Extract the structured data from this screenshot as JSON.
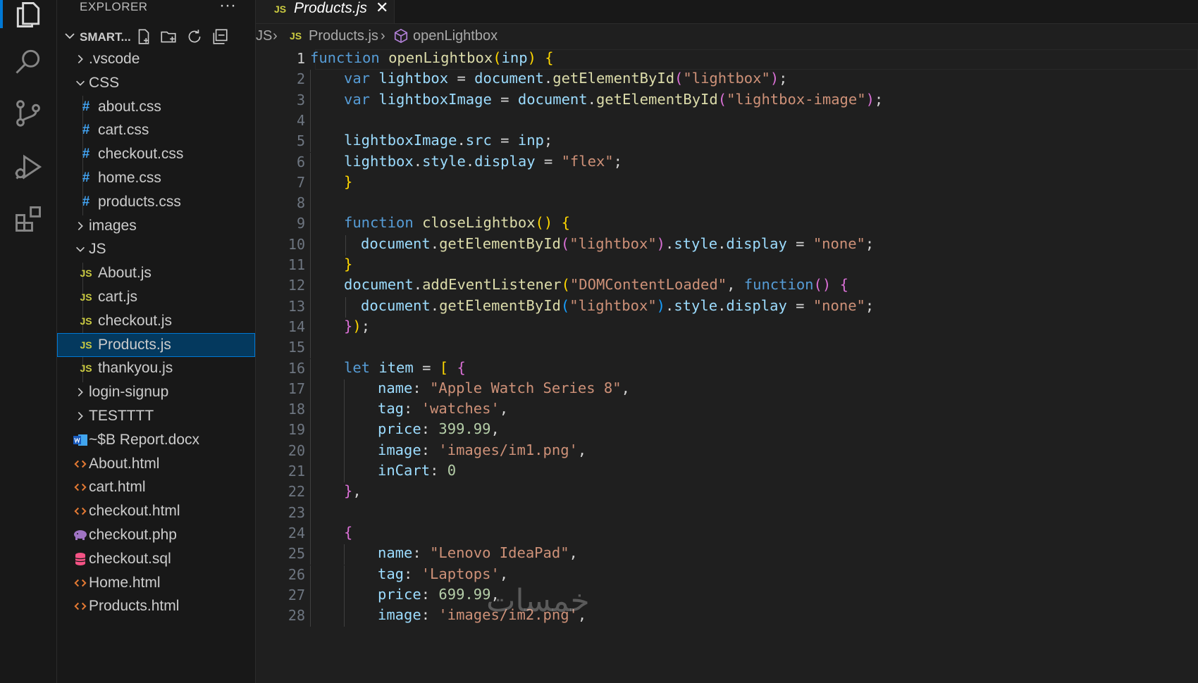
{
  "sidebar": {
    "title": "EXPLORER",
    "more": "···",
    "workspace": "SMART...",
    "items": [
      {
        "label": ".vscode",
        "icon": "chevron-right",
        "depth": 0
      },
      {
        "label": "CSS",
        "icon": "chevron-down",
        "depth": 0
      },
      {
        "label": "about.css",
        "icon": "#",
        "depth": 1
      },
      {
        "label": "cart.css",
        "icon": "#",
        "depth": 1
      },
      {
        "label": "checkout.css",
        "icon": "#",
        "depth": 1
      },
      {
        "label": "home.css",
        "icon": "#",
        "depth": 1
      },
      {
        "label": "products.css",
        "icon": "#",
        "depth": 1
      },
      {
        "label": "images",
        "icon": "chevron-right",
        "depth": 0
      },
      {
        "label": "JS",
        "icon": "chevron-down",
        "depth": 0
      },
      {
        "label": "About.js",
        "icon": "JS",
        "depth": 1
      },
      {
        "label": "cart.js",
        "icon": "JS",
        "depth": 1
      },
      {
        "label": "checkout.js",
        "icon": "JS",
        "depth": 1
      },
      {
        "label": "Products.js",
        "icon": "JS",
        "depth": 1,
        "selected": true
      },
      {
        "label": "thankyou.js",
        "icon": "JS",
        "depth": 1
      },
      {
        "label": "login-signup",
        "icon": "chevron-right",
        "depth": 0
      },
      {
        "label": "TESTTTT",
        "icon": "chevron-right",
        "depth": 0
      },
      {
        "label": "~$B Report.docx",
        "icon": "word",
        "depth": 0
      },
      {
        "label": "About.html",
        "icon": "html",
        "depth": 0
      },
      {
        "label": "cart.html",
        "icon": "html",
        "depth": 0
      },
      {
        "label": "checkout.html",
        "icon": "html",
        "depth": 0
      },
      {
        "label": "checkout.php",
        "icon": "php",
        "depth": 0
      },
      {
        "label": "checkout.sql",
        "icon": "sql",
        "depth": 0
      },
      {
        "label": "Home.html",
        "icon": "html",
        "depth": 0
      },
      {
        "label": "Products.html",
        "icon": "html",
        "depth": 0
      }
    ]
  },
  "tab": {
    "badge": "JS",
    "name": "Products.js",
    "close": "✕"
  },
  "breadcrumb": {
    "folder": "JS",
    "sep": "›",
    "badge": "JS",
    "file": "Products.js",
    "symbol": "openLightbox"
  },
  "editor": {
    "active_line": 1,
    "lines": [
      {
        "n": "1",
        "indent": 0,
        "tokens": [
          [
            "kw",
            "function "
          ],
          [
            "fn",
            "openLightbox"
          ],
          [
            "b1",
            "("
          ],
          [
            "vr",
            "inp"
          ],
          [
            "b1",
            ")"
          ],
          [
            "op",
            " "
          ],
          [
            "b1",
            "{"
          ]
        ]
      },
      {
        "n": "2",
        "indent": 1,
        "tokens": [
          [
            "kw",
            "var "
          ],
          [
            "vr",
            "lightbox"
          ],
          [
            "op",
            " = "
          ],
          [
            "vr",
            "document"
          ],
          [
            "op",
            "."
          ],
          [
            "fn",
            "getElementById"
          ],
          [
            "b2",
            "("
          ],
          [
            "st",
            "\"lightbox\""
          ],
          [
            "b2",
            ")"
          ],
          [
            "op",
            ";"
          ]
        ]
      },
      {
        "n": "3",
        "indent": 1,
        "tokens": [
          [
            "kw",
            "var "
          ],
          [
            "vr",
            "lightboxImage"
          ],
          [
            "op",
            " = "
          ],
          [
            "vr",
            "document"
          ],
          [
            "op",
            "."
          ],
          [
            "fn",
            "getElementById"
          ],
          [
            "b2",
            "("
          ],
          [
            "st",
            "\"lightbox-image\""
          ],
          [
            "b2",
            ")"
          ],
          [
            "op",
            ";"
          ]
        ]
      },
      {
        "n": "4",
        "indent": 1,
        "tokens": []
      },
      {
        "n": "5",
        "indent": 1,
        "tokens": [
          [
            "vr",
            "lightboxImage"
          ],
          [
            "op",
            "."
          ],
          [
            "vr",
            "src"
          ],
          [
            "op",
            " = "
          ],
          [
            "vr",
            "inp"
          ],
          [
            "op",
            ";"
          ]
        ]
      },
      {
        "n": "6",
        "indent": 1,
        "tokens": [
          [
            "vr",
            "lightbox"
          ],
          [
            "op",
            "."
          ],
          [
            "vr",
            "style"
          ],
          [
            "op",
            "."
          ],
          [
            "vr",
            "display"
          ],
          [
            "op",
            " = "
          ],
          [
            "st",
            "\"flex\""
          ],
          [
            "op",
            ";"
          ]
        ]
      },
      {
        "n": "7",
        "indent": 1,
        "tokens": [
          [
            "b1",
            "}"
          ]
        ]
      },
      {
        "n": "8",
        "indent": 1,
        "tokens": []
      },
      {
        "n": "9",
        "indent": 1,
        "tokens": [
          [
            "kw",
            "function "
          ],
          [
            "fn",
            "closeLightbox"
          ],
          [
            "b1",
            "()"
          ],
          [
            "op",
            " "
          ],
          [
            "b1",
            "{"
          ]
        ]
      },
      {
        "n": "10",
        "indent": 1.5,
        "tokens": [
          [
            "vr",
            "document"
          ],
          [
            "op",
            "."
          ],
          [
            "fn",
            "getElementById"
          ],
          [
            "b2",
            "("
          ],
          [
            "st",
            "\"lightbox\""
          ],
          [
            "b2",
            ")"
          ],
          [
            "op",
            "."
          ],
          [
            "vr",
            "style"
          ],
          [
            "op",
            "."
          ],
          [
            "vr",
            "display"
          ],
          [
            "op",
            " = "
          ],
          [
            "st",
            "\"none\""
          ],
          [
            "op",
            ";"
          ]
        ]
      },
      {
        "n": "11",
        "indent": 1,
        "tokens": [
          [
            "b1",
            "}"
          ]
        ]
      },
      {
        "n": "12",
        "indent": 1,
        "tokens": [
          [
            "vr",
            "document"
          ],
          [
            "op",
            "."
          ],
          [
            "fn",
            "addEventListener"
          ],
          [
            "b1",
            "("
          ],
          [
            "st",
            "\"DOMContentLoaded\""
          ],
          [
            "op",
            ", "
          ],
          [
            "kw",
            "function"
          ],
          [
            "b2",
            "()"
          ],
          [
            "op",
            " "
          ],
          [
            "b2",
            "{"
          ]
        ]
      },
      {
        "n": "13",
        "indent": 1.5,
        "tokens": [
          [
            "vr",
            "document"
          ],
          [
            "op",
            "."
          ],
          [
            "fn",
            "getElementById"
          ],
          [
            "b3",
            "("
          ],
          [
            "st",
            "\"lightbox\""
          ],
          [
            "b3",
            ")"
          ],
          [
            "op",
            "."
          ],
          [
            "vr",
            "style"
          ],
          [
            "op",
            "."
          ],
          [
            "vr",
            "display"
          ],
          [
            "op",
            " = "
          ],
          [
            "st",
            "\"none\""
          ],
          [
            "op",
            ";"
          ]
        ]
      },
      {
        "n": "14",
        "indent": 1,
        "tokens": [
          [
            "b2",
            "}"
          ],
          [
            "b1",
            ")"
          ],
          [
            "op",
            ";"
          ]
        ]
      },
      {
        "n": "15",
        "indent": 1,
        "tokens": []
      },
      {
        "n": "16",
        "indent": 1,
        "tokens": [
          [
            "kw",
            "let "
          ],
          [
            "vr",
            "item"
          ],
          [
            "op",
            " = "
          ],
          [
            "b1",
            "["
          ],
          [
            "op",
            " "
          ],
          [
            "b2",
            "{"
          ]
        ]
      },
      {
        "n": "17",
        "indent": 2,
        "tokens": [
          [
            "vr",
            "name"
          ],
          [
            "op",
            ": "
          ],
          [
            "st",
            "\"Apple Watch Series 8\""
          ],
          [
            "op",
            ","
          ]
        ]
      },
      {
        "n": "18",
        "indent": 2,
        "tokens": [
          [
            "vr",
            "tag"
          ],
          [
            "op",
            ": "
          ],
          [
            "st",
            "'watches'"
          ],
          [
            "op",
            ","
          ]
        ]
      },
      {
        "n": "19",
        "indent": 2,
        "tokens": [
          [
            "vr",
            "price"
          ],
          [
            "op",
            ": "
          ],
          [
            "nm",
            "399.99"
          ],
          [
            "op",
            ","
          ]
        ]
      },
      {
        "n": "20",
        "indent": 2,
        "tokens": [
          [
            "vr",
            "image"
          ],
          [
            "op",
            ": "
          ],
          [
            "st",
            "'images/im1.png'"
          ],
          [
            "op",
            ","
          ]
        ]
      },
      {
        "n": "21",
        "indent": 2,
        "tokens": [
          [
            "vr",
            "inCart"
          ],
          [
            "op",
            ": "
          ],
          [
            "nm",
            "0"
          ]
        ]
      },
      {
        "n": "22",
        "indent": 1,
        "tokens": [
          [
            "b2",
            "}"
          ],
          [
            "op",
            ","
          ]
        ]
      },
      {
        "n": "23",
        "indent": 1,
        "tokens": []
      },
      {
        "n": "24",
        "indent": 1,
        "tokens": [
          [
            "b2",
            "{"
          ]
        ]
      },
      {
        "n": "25",
        "indent": 2,
        "tokens": [
          [
            "vr",
            "name"
          ],
          [
            "op",
            ": "
          ],
          [
            "st",
            "\"Lenovo IdeaPad\""
          ],
          [
            "op",
            ","
          ]
        ]
      },
      {
        "n": "26",
        "indent": 2,
        "tokens": [
          [
            "vr",
            "tag"
          ],
          [
            "op",
            ": "
          ],
          [
            "st",
            "'Laptops'"
          ],
          [
            "op",
            ","
          ]
        ]
      },
      {
        "n": "27",
        "indent": 2,
        "tokens": [
          [
            "vr",
            "price"
          ],
          [
            "op",
            ": "
          ],
          [
            "nm",
            "699.99"
          ],
          [
            "op",
            ","
          ]
        ]
      },
      {
        "n": "28",
        "indent": 2,
        "tokens": [
          [
            "vr",
            "image"
          ],
          [
            "op",
            ": "
          ],
          [
            "st",
            "'images/im2.png'"
          ],
          [
            "op",
            ","
          ]
        ]
      }
    ]
  },
  "watermark": "خمسات",
  "colors": {
    "accent": "#0078d4",
    "selection": "#04395e",
    "js_badge": "#cbcb41",
    "css_badge": "#42a5f5",
    "html_badge": "#e37933"
  }
}
